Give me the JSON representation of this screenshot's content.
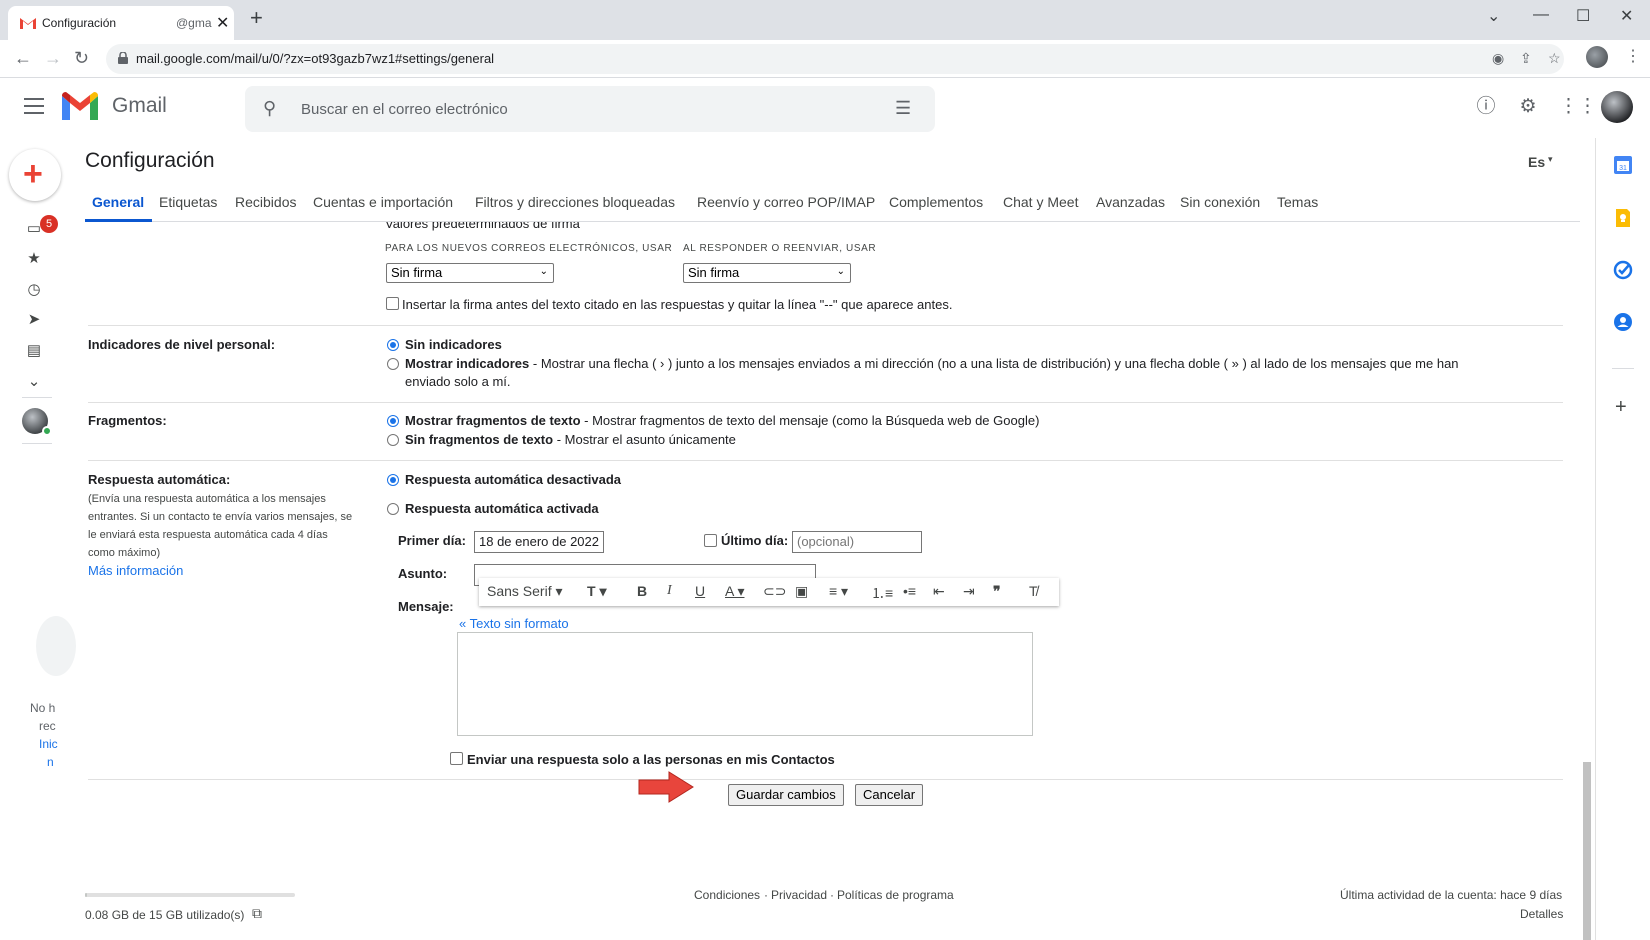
{
  "browser": {
    "tab_title": "Configuración",
    "tab_title_suffix": "@gma",
    "url": "mail.google.com/mail/u/0/?zx=ot93gazb7wz1#settings/general"
  },
  "header": {
    "app_name": "Gmail",
    "search_placeholder": "Buscar en el correo electrónico"
  },
  "rail": {
    "inbox_badge": "5",
    "promo_line1": "No h",
    "promo_line2": "rec",
    "promo_link1": "Inic",
    "promo_link2": "n"
  },
  "settings": {
    "title": "Configuración",
    "language": "Es",
    "tabs": [
      "General",
      "Etiquetas",
      "Recibidos",
      "Cuentas e importación",
      "Filtros y direcciones bloqueadas",
      "Reenvío y correo POP/IMAP",
      "Complementos",
      "Chat y Meet",
      "Avanzadas",
      "Sin conexión",
      "Temas"
    ],
    "signature": {
      "cut_heading": "Valores predeterminados de firma",
      "new_label": "PARA LOS NUEVOS CORREOS ELECTRÓNICOS, USAR",
      "reply_label": "AL RESPONDER O REENVIAR, USAR",
      "new_value": "Sin firma",
      "reply_value": "Sin firma",
      "insert_before": "Insertar la firma antes del texto citado en las respuestas y quitar la línea \"--\" que aparece antes."
    },
    "indicators": {
      "label": "Indicadores de nivel personal:",
      "opt1": "Sin indicadores",
      "opt2_bold": "Mostrar indicadores",
      "opt2_desc": " - Mostrar una flecha ( › ) junto a los mensajes enviados a mi dirección (no a una lista de distribución) y una flecha doble ( » ) al lado de los mensajes que me han",
      "opt2_desc2": "enviado solo a mí."
    },
    "snippets": {
      "label": "Fragmentos:",
      "opt1_bold": "Mostrar fragmentos de texto",
      "opt1_desc": " - Mostrar fragmentos de texto del mensaje (como la Búsqueda web de Google)",
      "opt2_bold": "Sin fragmentos de texto",
      "opt2_desc": " - Mostrar el asunto únicamente"
    },
    "autoreply": {
      "label": "Respuesta automática:",
      "note1": "(Envía una respuesta automática a los mensajes",
      "note2": "entrantes. Si un contacto te envía varios mensajes, se",
      "note3": "le enviará esta respuesta automática cada 4 días",
      "note4": "como máximo)",
      "more_info": "Más información",
      "off": "Respuesta automática desactivada",
      "on": "Respuesta automática activada",
      "first_day_label": "Primer día:",
      "first_day_value": "18 de enero de 2022",
      "last_day_label": "Último día:",
      "last_day_placeholder": "(opcional)",
      "subject_label": "Asunto:",
      "message_label": "Mensaje:",
      "font": "Sans Serif",
      "plain_text": "« Texto sin formato",
      "contacts_only": "Enviar una respuesta solo a las personas en mis Contactos"
    },
    "save_button": "Guardar cambios",
    "cancel_button": "Cancelar"
  },
  "footer": {
    "storage": "0.08 GB de 15 GB utilizado(s)",
    "storage_fraction": 0.005,
    "terms": "Condiciones",
    "privacy": "Privacidad",
    "policies": "Políticas de programa",
    "sep": "·",
    "last_activity": "Última actividad de la cuenta: hace 9 días",
    "details": "Detalles"
  },
  "colors": {
    "accent": "#0b57d0",
    "link": "#1a73e8",
    "badge": "#d93025",
    "arrow": "#e8453c"
  }
}
